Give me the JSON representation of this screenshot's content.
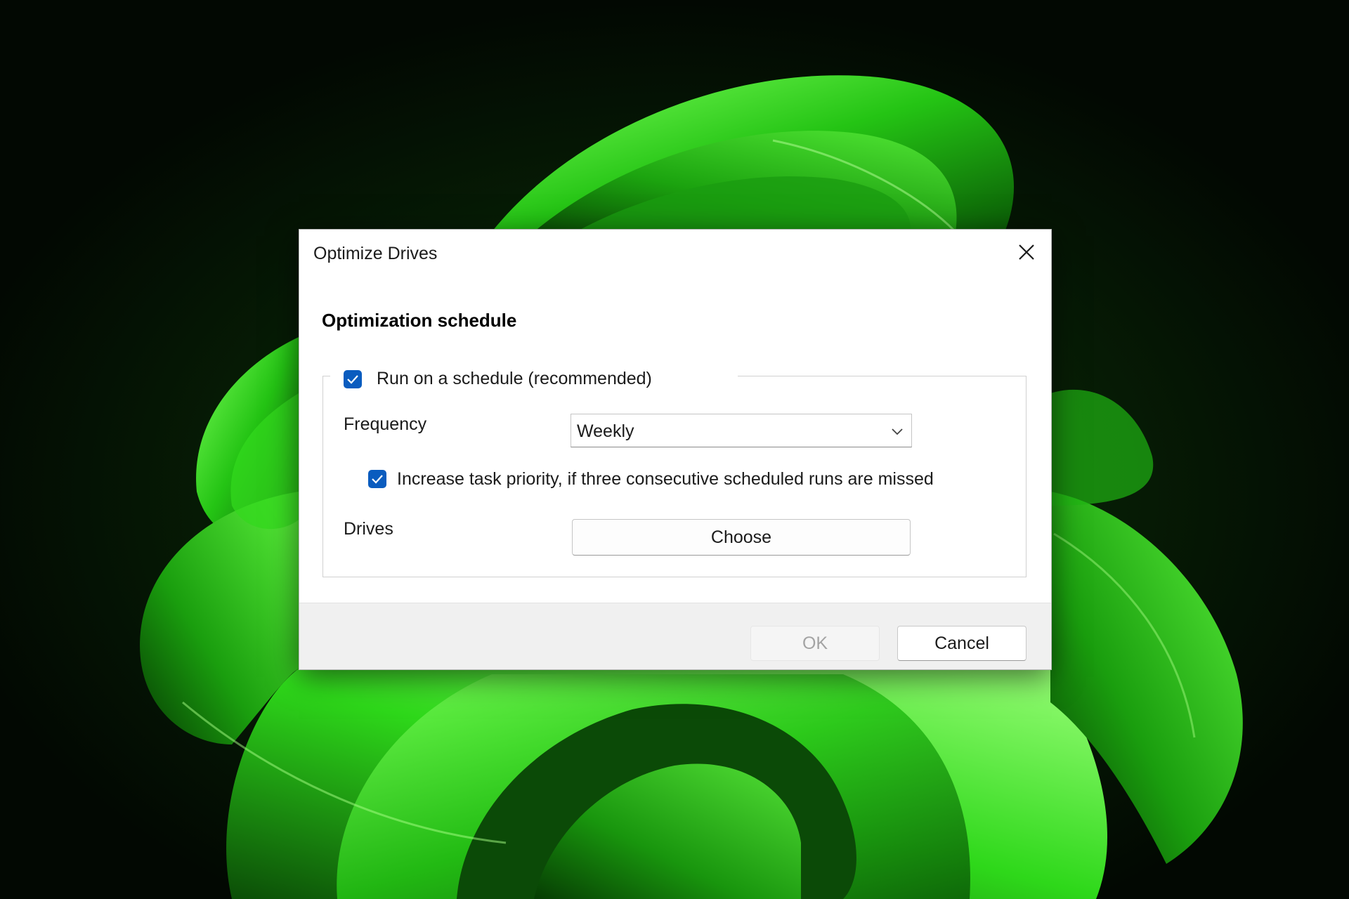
{
  "window": {
    "title": "Optimize Drives",
    "close_icon": "close-icon"
  },
  "content": {
    "heading": "Optimization schedule",
    "schedule_checkbox": {
      "label": "Run on a schedule (recommended)",
      "checked": true
    },
    "frequency": {
      "label": "Frequency",
      "selected": "Weekly",
      "dropdown_icon": "chevron-down-icon"
    },
    "priority_checkbox": {
      "label": "Increase task priority, if three consecutive scheduled runs are missed",
      "checked": true
    },
    "drives": {
      "label": "Drives",
      "button": "Choose"
    }
  },
  "footer": {
    "ok_label": "OK",
    "ok_enabled": false,
    "cancel_label": "Cancel"
  },
  "colors": {
    "accent": "#0a5cbf",
    "wallpaper_green": "#2fd21a",
    "wallpaper_dark": "#020802",
    "disabled_text": "#a3a3a3"
  }
}
